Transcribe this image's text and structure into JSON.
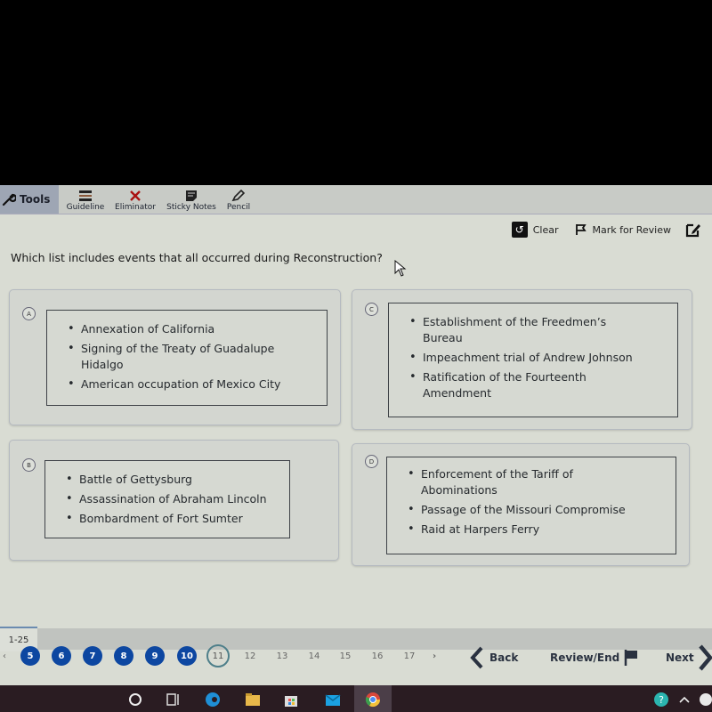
{
  "toolbar": {
    "tools_label": "Tools",
    "items": [
      {
        "label": "Guideline",
        "icon": "guideline-icon"
      },
      {
        "label": "Eliminator",
        "icon": "eliminator-x-icon"
      },
      {
        "label": "Sticky Notes",
        "icon": "sticky-note-icon"
      },
      {
        "label": "Pencil",
        "icon": "pencil-icon"
      }
    ]
  },
  "actions": {
    "clear_label": "Clear",
    "mark_review_label": "Mark for Review"
  },
  "question": {
    "text": "Which list includes events that all occurred during Reconstruction?"
  },
  "options": [
    {
      "letter": "A",
      "items": [
        "Annexation of California",
        "Signing of the Treaty of Guadalupe Hidalgo",
        "American occupation of Mexico City"
      ]
    },
    {
      "letter": "C",
      "items": [
        "Establishment of the Freedmen’s Bureau",
        "Impeachment trial of Andrew Johnson",
        "Ratification of the Fourteenth Amendment"
      ]
    },
    {
      "letter": "B",
      "items": [
        "Battle of Gettysburg",
        "Assassination of Abraham Lincoln",
        "Bombardment of Fort Sumter"
      ]
    },
    {
      "letter": "D",
      "items": [
        "Enforcement of the Tariff of Abominations",
        "Passage of the Missouri Compromise",
        "Raid at Harpers Ferry"
      ]
    }
  ],
  "navigation": {
    "range_label": "1-25",
    "answered_pages": [
      "5",
      "6",
      "7",
      "8",
      "9",
      "10"
    ],
    "current_page": "11",
    "other_pages": [
      "12",
      "13",
      "14",
      "15",
      "16",
      "17"
    ],
    "back_label": "Back",
    "review_end_label": "Review/End",
    "next_label": "Next"
  },
  "colors": {
    "answered": "#0d47a1",
    "current_ring": "#4e7f8a"
  }
}
